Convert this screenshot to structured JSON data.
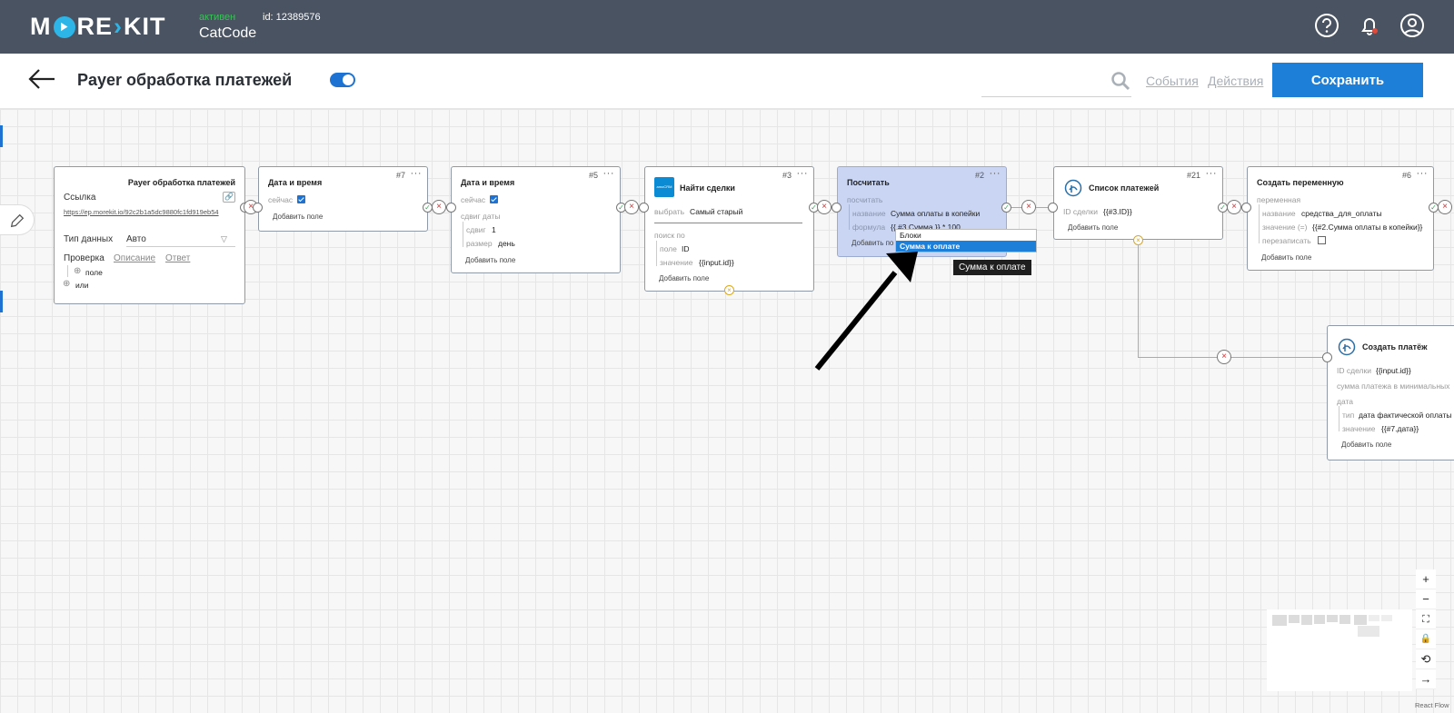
{
  "topbar": {
    "logo_text": "MORE KIT",
    "status": "активен",
    "id_label": "id: 12389576",
    "account_name": "CatCode",
    "icons": [
      "help-icon",
      "bell-icon",
      "user-icon"
    ]
  },
  "header": {
    "title": "Payer обработка платежей",
    "toggle_on": true,
    "tab_events": "События",
    "tab_actions": "Действия",
    "save_label": "Сохранить"
  },
  "nodes": {
    "trigger": {
      "title": "Payer обработка платежей",
      "link_label": "Ссылка",
      "link_url": "https://ep.morekit.io/92c2b1a5dc9880fc1fd919eb54",
      "type_label": "Тип данных",
      "type_value": "Авто",
      "tab_check": "Проверка",
      "tab_desc": "Описание",
      "tab_answer": "Ответ",
      "field": "поле",
      "or": "или"
    },
    "n7": {
      "title": "Дата и время",
      "num": "#7",
      "now_label": "сейчас",
      "add": "Добавить поле"
    },
    "n5": {
      "title": "Дата и время",
      "num": "#5",
      "now_label": "сейчас",
      "shift_label": "сдвиг даты",
      "shift_key": "сдвиг",
      "shift_val": "1",
      "size_key": "размер",
      "size_val": "день",
      "add": "Добавить поле"
    },
    "n3": {
      "title": "Найти сделки",
      "num": "#3",
      "choose_label": "выбрать",
      "choose_val": "Самый старый",
      "search_label": "поиск по",
      "field_key": "поле",
      "field_val": "ID",
      "value_key": "значение",
      "value_val": "{{input.id}}",
      "add": "Добавить поле"
    },
    "n2": {
      "title": "Посчитать",
      "num": "#2",
      "calc_label": "посчитать",
      "name_key": "название",
      "name_val": "Сумма оплаты в копейки",
      "formula_key": "формула",
      "formula_val": "{{ #3.Сумма }} * 100",
      "add": "Добавить по"
    },
    "n21": {
      "title": "Список платежей",
      "num": "#21",
      "deal_key": "ID сделки",
      "deal_val": "{{#3.ID}}",
      "add": "Добавить поле"
    },
    "n6": {
      "title": "Создать переменную",
      "num": "#6",
      "var_label": "переменная",
      "name_key": "название",
      "name_val": "средства_для_оплаты",
      "value_key": "значение (=)",
      "value_val": "{{#2.Сумма оплаты в копейки}}",
      "overwrite_key": "перезаписать",
      "add": "Добавить поле"
    },
    "create_payment": {
      "title": "Создать платёж",
      "deal_key": "ID сделки",
      "deal_val": "{{input.id}}",
      "sum_label": "сумма платежа в минимальных",
      "date_label": "дата",
      "type_key": "тип",
      "type_val": "дата фактической оплаты",
      "value_key": "значение",
      "value_val": "{{#7.дата}}",
      "add": "Добавить поле"
    }
  },
  "autocomplete": {
    "items": [
      "Блоки",
      "Сумма к оплате"
    ],
    "active_index": 1,
    "tooltip": "Сумма к оплате"
  },
  "zoom_controls": [
    "+",
    "−",
    "⛶",
    "🔒",
    "⟲",
    "→"
  ],
  "attribution": "React Flow",
  "colors": {
    "topbar": "#4a5361",
    "accent": "#1e7fd8",
    "selected_node": "#c9d5f3",
    "status_green": "#3bbf5a"
  }
}
